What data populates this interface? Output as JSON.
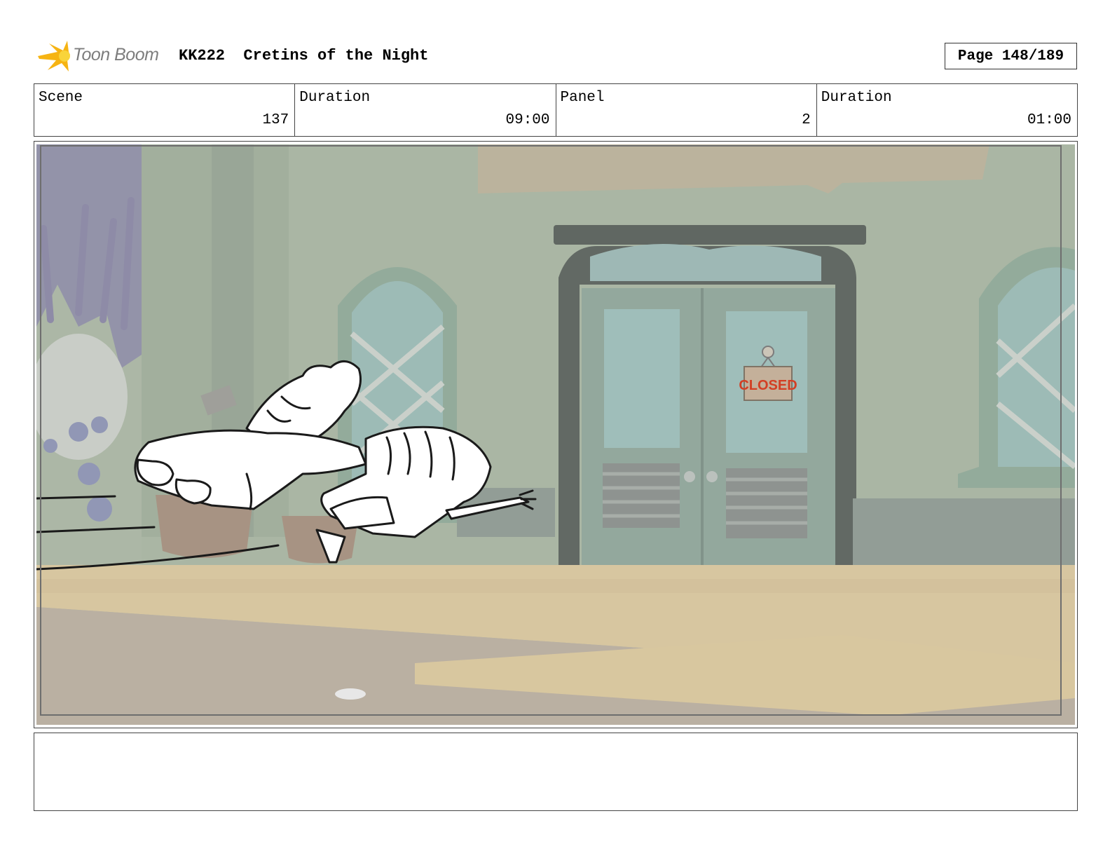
{
  "header": {
    "logo_text": "Toon Boom",
    "episode": "KK222",
    "title": "Cretins of the Night",
    "page": "Page 148/189"
  },
  "info": {
    "scene_label": "Scene",
    "scene_value": "137",
    "scene_duration_label": "Duration",
    "scene_duration_value": "09:00",
    "panel_label": "Panel",
    "panel_value": "2",
    "panel_duration_label": "Duration",
    "panel_duration_value": "01:00"
  },
  "panel": {
    "sign_text": "CLOSED"
  },
  "notes": {
    "text": ""
  }
}
